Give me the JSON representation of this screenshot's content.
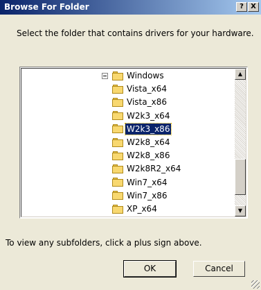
{
  "window": {
    "title": "Browse For Folder",
    "help_button": "?",
    "close_button": "X"
  },
  "prompt": "Select the folder that contains drivers for your hardware.",
  "tree": {
    "parent": "Windows",
    "items": [
      "Vista_x64",
      "Vista_x86",
      "W2k3_x64",
      "W2k3_x86",
      "W2k8_x64",
      "W2k8_x86",
      "W2k8R2_x64",
      "Win7_x64",
      "Win7_x86",
      "XP_x64"
    ],
    "selected": "W2k3_x86"
  },
  "scrollbar": {
    "up_arrow": "▲",
    "down_arrow": "▼"
  },
  "hint": "To view any subfolders, click a plus sign above.",
  "buttons": {
    "ok": "OK",
    "cancel": "Cancel"
  },
  "colors": {
    "title_bar": "#0a246a",
    "selection": "#0a246a",
    "folder": "#f8d870"
  }
}
